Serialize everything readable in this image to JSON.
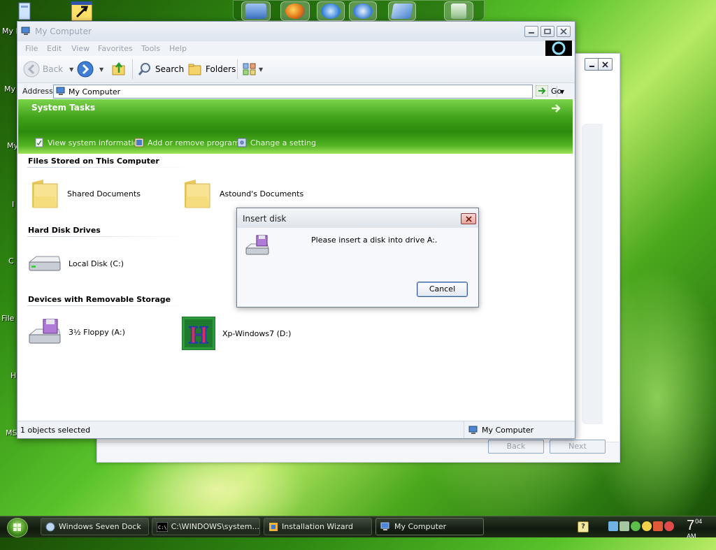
{
  "desktop": {
    "side_labels": [
      "My I",
      "My",
      "My",
      "I",
      "C",
      "File",
      "H",
      "MS"
    ]
  },
  "wizard_window": {
    "back_label": "Back",
    "next_label": "Next"
  },
  "window": {
    "title": "My Computer",
    "menu": [
      "File",
      "Edit",
      "View",
      "Favorites",
      "Tools",
      "Help"
    ],
    "toolbar": {
      "back_label": "Back",
      "search_label": "Search",
      "folders_label": "Folders"
    },
    "address": {
      "label": "Address",
      "value": "My Computer",
      "go_label": "Go"
    },
    "system_tasks": {
      "title": "System Tasks",
      "links": [
        "View system information",
        "Add or remove programs",
        "Change a setting"
      ]
    },
    "groups": {
      "files": {
        "title": "Files Stored on This Computer",
        "items": [
          "Shared Documents",
          "Astound's Documents"
        ]
      },
      "hdd": {
        "title": "Hard Disk Drives",
        "items": [
          "Local Disk (C:)"
        ]
      },
      "removable": {
        "title": "Devices with Removable Storage",
        "items": [
          "3½ Floppy (A:)",
          "Xp-Windows7 (D:)"
        ]
      }
    },
    "status": {
      "left": "1 objects selected",
      "right": "My Computer"
    }
  },
  "dialog": {
    "title": "Insert disk",
    "message": "Please insert a disk into drive A:.",
    "cancel_label": "Cancel"
  },
  "taskbar": {
    "buttons": [
      "Windows Seven Dock",
      "C:\\WINDOWS\\system...",
      "Installation Wizard",
      "My Computer"
    ],
    "clock_hour": "7",
    "clock_minute": "04",
    "clock_ampm": "AM"
  },
  "colors": {
    "accent_green": "#3ea119",
    "taskbar": "#101a0e",
    "dialog_border": "#707c8c"
  }
}
